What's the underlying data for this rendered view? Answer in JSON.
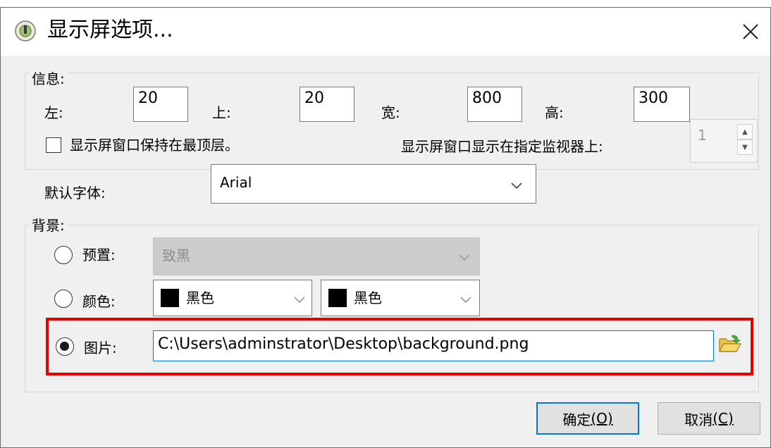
{
  "dialog": {
    "title": "显示屏选项...",
    "icon": "display-options-icon"
  },
  "info": {
    "caption": "信息:",
    "left_label": "左:",
    "left_value": "20",
    "top_label": "上:",
    "top_value": "20",
    "width_label": "宽:",
    "width_value": "800",
    "height_label": "高:",
    "height_value": "300",
    "topmost_label": "显示屏窗口保持在最顶层。",
    "topmost_checked": false,
    "monitor_label": "显示屏窗口显示在指定监视器上:",
    "monitor_value": "1"
  },
  "font": {
    "label": "默认字体:",
    "value": "Arial"
  },
  "background": {
    "caption": "背景:",
    "preset_label": "预置:",
    "preset_value": "致黑",
    "color_label": "颜色:",
    "color1_value": "黑色",
    "color2_value": "黑色",
    "color_swatch": "#000000",
    "image_label": "图片:",
    "image_path": "C:\\Users\\adminstrator\\Desktop\\background.png",
    "selected": "image"
  },
  "buttons": {
    "ok_label": "确定",
    "ok_mnemonic": "(O)",
    "cancel_label": "取消",
    "cancel_mnemonic": "(C)"
  },
  "colors": {
    "highlight": "#e60000",
    "focus": "#0078d7"
  }
}
